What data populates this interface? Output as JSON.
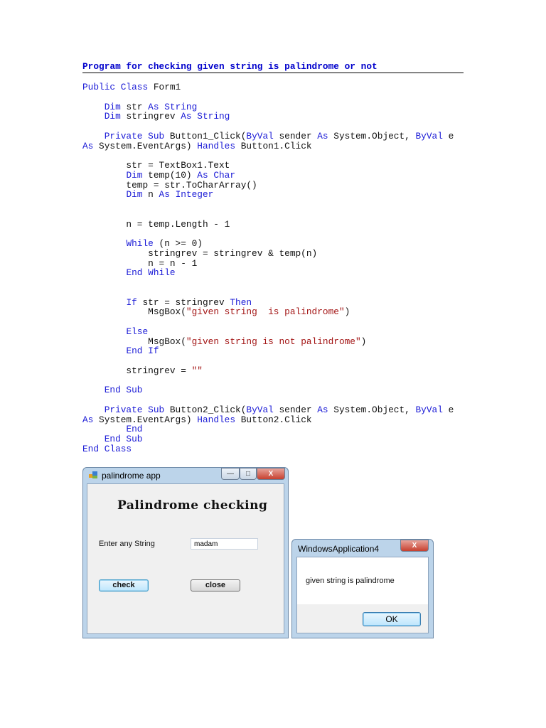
{
  "title": "Program for checking given string is palindrome or not",
  "code": {
    "lines": [
      [
        {
          "t": "Public Class",
          "k": "kw"
        },
        {
          "t": " Form1"
        }
      ],
      [],
      [
        {
          "t": "    "
        },
        {
          "t": "Dim",
          "k": "kw"
        },
        {
          "t": " str "
        },
        {
          "t": "As String",
          "k": "kw"
        }
      ],
      [
        {
          "t": "    "
        },
        {
          "t": "Dim",
          "k": "kw"
        },
        {
          "t": " stringrev "
        },
        {
          "t": "As String",
          "k": "kw"
        }
      ],
      [],
      [
        {
          "t": "    "
        },
        {
          "t": "Private Sub",
          "k": "kw"
        },
        {
          "t": " Button1_Click("
        },
        {
          "t": "ByVal",
          "k": "kw"
        },
        {
          "t": " sender "
        },
        {
          "t": "As",
          "k": "kw"
        },
        {
          "t": " System.Object, "
        },
        {
          "t": "ByVal",
          "k": "kw"
        },
        {
          "t": " e"
        }
      ],
      [
        {
          "t": "As",
          "k": "kw"
        },
        {
          "t": " System.EventArgs) "
        },
        {
          "t": "Handles",
          "k": "kw"
        },
        {
          "t": " Button1.Click"
        }
      ],
      [],
      [
        {
          "t": "        str = TextBox1.Text"
        }
      ],
      [
        {
          "t": "        "
        },
        {
          "t": "Dim",
          "k": "kw"
        },
        {
          "t": " temp(10) "
        },
        {
          "t": "As Char",
          "k": "kw"
        }
      ],
      [
        {
          "t": "        temp = str.ToCharArray()"
        }
      ],
      [
        {
          "t": "        "
        },
        {
          "t": "Dim",
          "k": "kw"
        },
        {
          "t": " n "
        },
        {
          "t": "As Integer",
          "k": "kw"
        }
      ],
      [],
      [],
      [
        {
          "t": "        n = temp.Length - 1"
        }
      ],
      [],
      [
        {
          "t": "        "
        },
        {
          "t": "While",
          "k": "kw"
        },
        {
          "t": " (n >= 0)"
        }
      ],
      [
        {
          "t": "            stringrev = stringrev & temp(n)"
        }
      ],
      [
        {
          "t": "            n = n - 1"
        }
      ],
      [
        {
          "t": "        "
        },
        {
          "t": "End While",
          "k": "kw"
        }
      ],
      [],
      [],
      [
        {
          "t": "        "
        },
        {
          "t": "If",
          "k": "kw"
        },
        {
          "t": " str = stringrev "
        },
        {
          "t": "Then",
          "k": "kw"
        }
      ],
      [
        {
          "t": "            MsgBox("
        },
        {
          "t": "\"given string  is palindrome\"",
          "k": "str"
        },
        {
          "t": ")"
        }
      ],
      [],
      [
        {
          "t": "        "
        },
        {
          "t": "Else",
          "k": "kw"
        }
      ],
      [
        {
          "t": "            MsgBox("
        },
        {
          "t": "\"given string is not palindrome\"",
          "k": "str"
        },
        {
          "t": ")"
        }
      ],
      [
        {
          "t": "        "
        },
        {
          "t": "End If",
          "k": "kw"
        }
      ],
      [],
      [
        {
          "t": "        stringrev = "
        },
        {
          "t": "\"\"",
          "k": "str"
        }
      ],
      [],
      [
        {
          "t": "    "
        },
        {
          "t": "End Sub",
          "k": "kw"
        }
      ],
      [],
      [
        {
          "t": "    "
        },
        {
          "t": "Private Sub",
          "k": "kw"
        },
        {
          "t": " Button2_Click("
        },
        {
          "t": "ByVal",
          "k": "kw"
        },
        {
          "t": " sender "
        },
        {
          "t": "As",
          "k": "kw"
        },
        {
          "t": " System.Object, "
        },
        {
          "t": "ByVal",
          "k": "kw"
        },
        {
          "t": " e"
        }
      ],
      [
        {
          "t": "As",
          "k": "kw"
        },
        {
          "t": " System.EventArgs) "
        },
        {
          "t": "Handles",
          "k": "kw"
        },
        {
          "t": " Button2.Click"
        }
      ],
      [
        {
          "t": "        "
        },
        {
          "t": "End",
          "k": "kw"
        }
      ],
      [
        {
          "t": "    "
        },
        {
          "t": "End Sub",
          "k": "kw"
        }
      ],
      [
        {
          "t": "End Class",
          "k": "kw"
        }
      ]
    ]
  },
  "app_window": {
    "title": "palindrome app",
    "heading": "Palindrome checking",
    "label": "Enter any String",
    "input_value": "madam",
    "check_label": "check",
    "close_label": "close",
    "min_glyph": "—",
    "max_glyph": "□",
    "close_glyph": "X"
  },
  "msgbox": {
    "title": "WindowsApplication4",
    "message": "given string  is palindrome",
    "ok_label": "OK",
    "close_glyph": "X"
  }
}
